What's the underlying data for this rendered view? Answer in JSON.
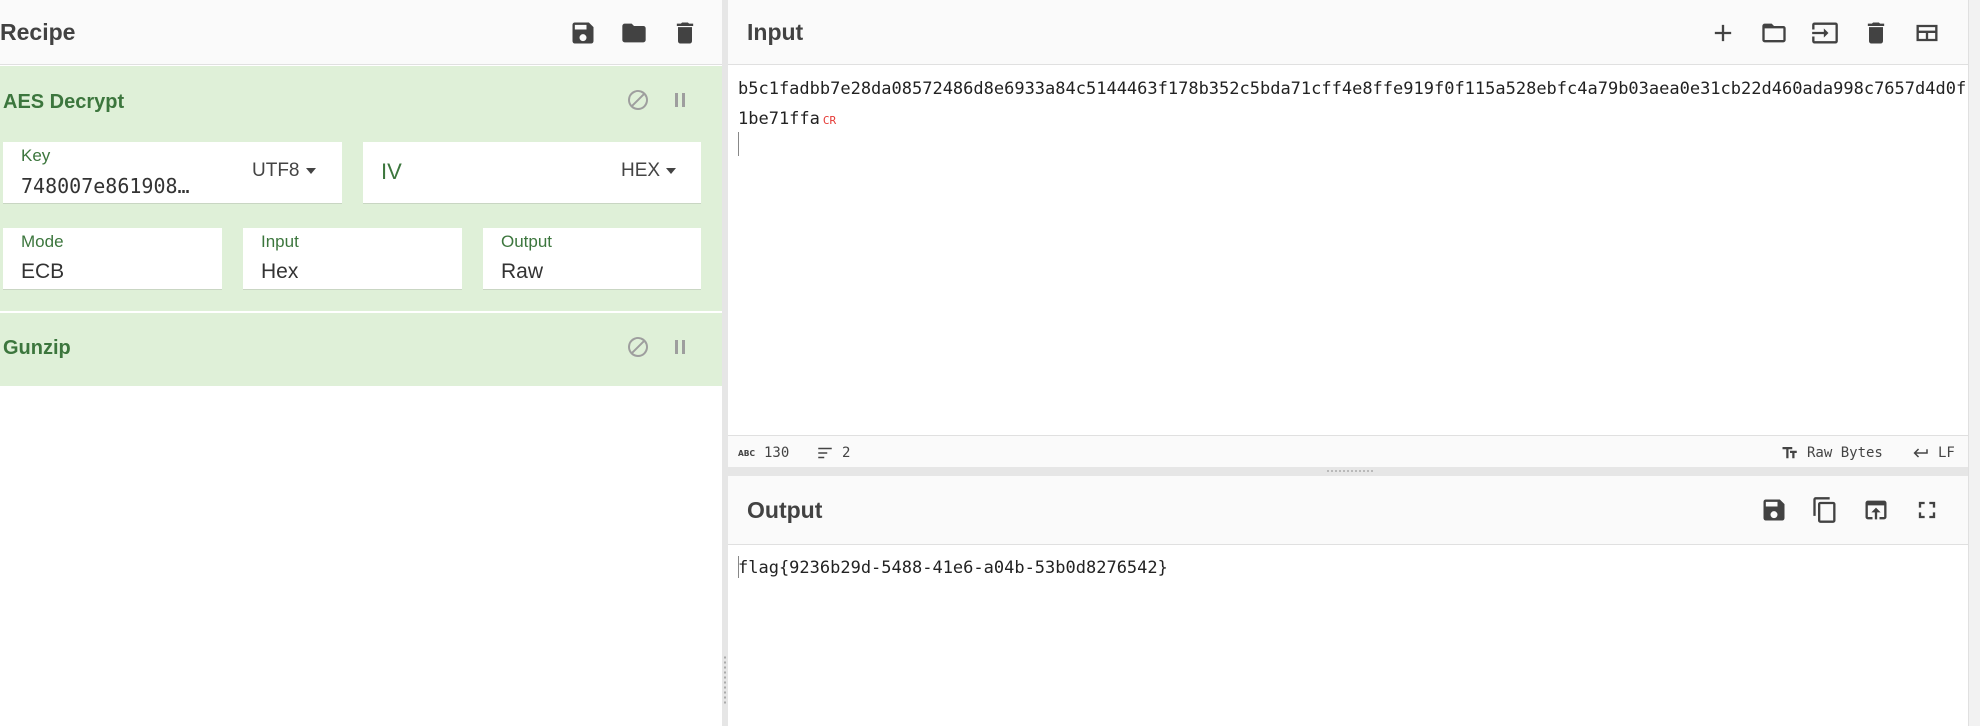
{
  "recipe": {
    "title": "Recipe",
    "header_icons": [
      "save-icon",
      "folder-icon",
      "trash-icon"
    ],
    "operations": [
      {
        "name": "AES Decrypt",
        "key_label": "Key",
        "key_value": "748007e861908…",
        "key_encoding": "UTF8",
        "iv_label": "IV",
        "iv_encoding": "HEX",
        "mode_label": "Mode",
        "mode_value": "ECB",
        "input_label": "Input",
        "input_value": "Hex",
        "output_label": "Output",
        "output_value": "Raw"
      },
      {
        "name": "Gunzip"
      }
    ]
  },
  "input": {
    "title": "Input",
    "text": "b5c1fadbb7e28da08572486d8e6933a84c5144463f178b352c5bda71cff4e8ffe919f0f115a528ebfc4a79b03aea0e31cb22d460ada998c7657d4d0f1be71ffa",
    "line_ending_marker": "CR",
    "status": {
      "char_count": "130",
      "line_count": "2",
      "encoding": "Raw Bytes",
      "eol": "LF"
    }
  },
  "output": {
    "title": "Output",
    "text": "flag{9236b29d-5488-41e6-a04b-53b0d8276542}"
  },
  "colors": {
    "op_background": "#dff0d8",
    "op_title": "#3c763d",
    "cr_marker": "#e53935"
  }
}
